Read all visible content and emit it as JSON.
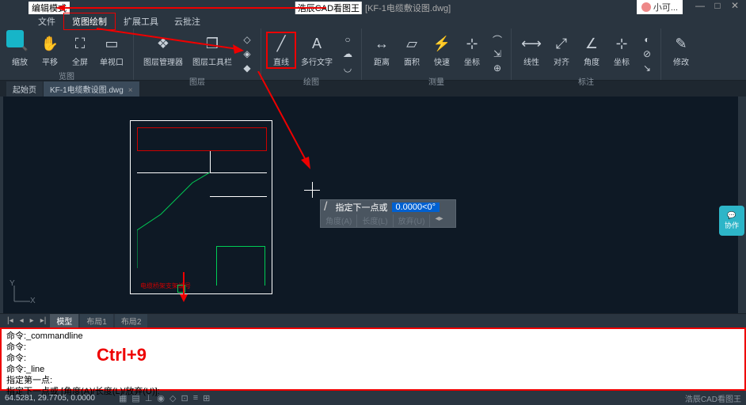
{
  "topbar": {
    "edit_mode": "编辑模式",
    "app_title": "浩辰CAD看图王",
    "file_name": "[KF-1电缆敷设图.dwg]",
    "user": "小可...",
    "min": "—",
    "max": "□",
    "close": "✕"
  },
  "menu": {
    "file": "文件",
    "view_draw": "览图绘制",
    "ext_tools": "扩展工具",
    "cloud": "云批注"
  },
  "ribbon": {
    "zoom": "缩放",
    "pan": "平移",
    "fullscreen": "全屏",
    "vport": "单视口",
    "layermgr": "图层管理器",
    "layertools": "图层工具栏",
    "line": "直线",
    "mtext": "多行文字",
    "dist": "距离",
    "area": "面积",
    "quick": "快速",
    "coord": "坐标",
    "linear": "线性",
    "align": "对齐",
    "angle": "角度",
    "coord2": "坐标",
    "modify": "修改",
    "g_view": "览图",
    "g_layer": "图层",
    "g_draw": "绘图",
    "g_measure": "测量",
    "g_annotate": "标注"
  },
  "tabs": {
    "start": "起始页",
    "file": "KF-1电缆敷设图.dwg"
  },
  "canvas": {
    "input_line_icon": "/",
    "input_hint": "指定下一点或",
    "input_value": "0.0000<0°",
    "opt1": "角度(A)",
    "opt2": "长度(L)",
    "opt3": "放弃(U)",
    "drawing_label": "电缆桥架支架编号"
  },
  "layouts": {
    "model": "模型",
    "l1": "布局1",
    "l2": "布局2"
  },
  "cmd": {
    "l1": "命令:_commandline",
    "l2": "命令:",
    "l3": "命令:",
    "l4": "命令:_line",
    "l5": "指定第一点:",
    "l6": "指定下一点或 [角度(A)/长度(L)/放弃(U)]:",
    "annotation": "Ctrl+9"
  },
  "status": {
    "coords": "64.5281, 29.7705, 0.0000",
    "brand": "浩辰CAD看图王"
  },
  "chat": "协作"
}
